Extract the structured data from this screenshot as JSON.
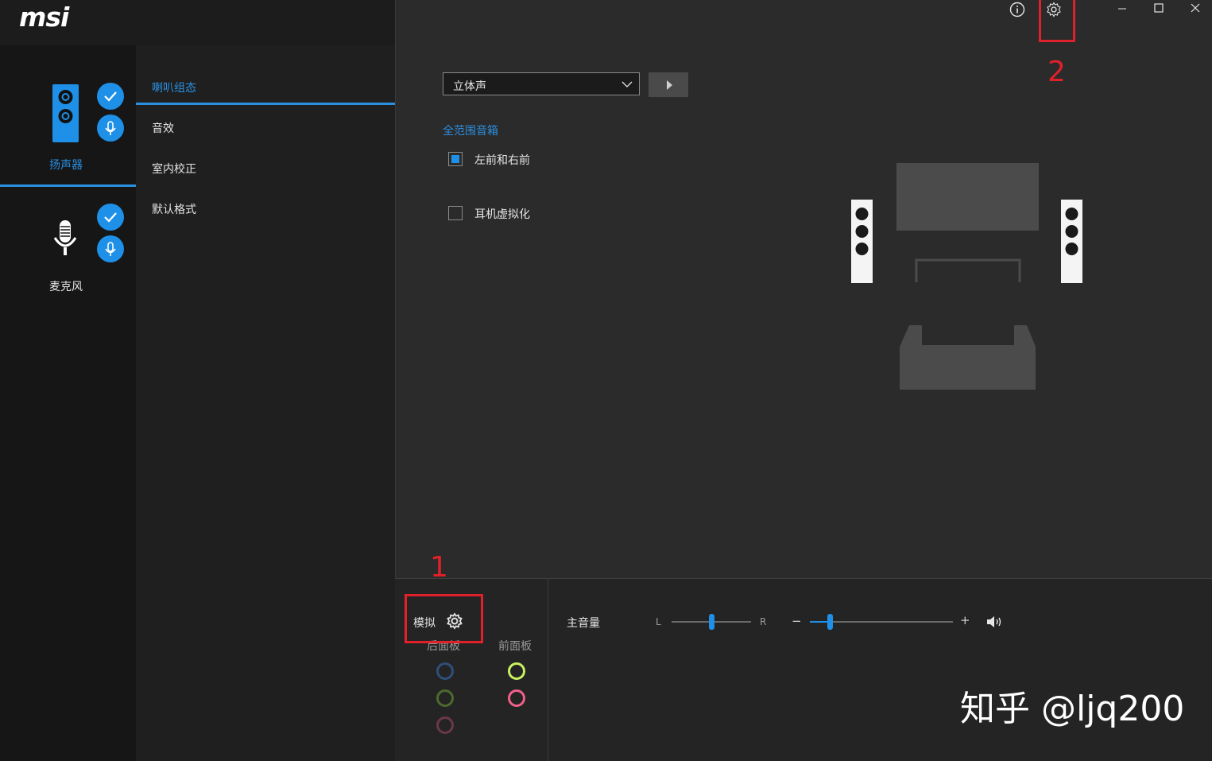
{
  "app": {
    "logo": "msi"
  },
  "devices": [
    {
      "label": "扬声器",
      "icon": "speaker-icon",
      "active": true
    },
    {
      "label": "麦克风",
      "icon": "microphone-icon",
      "active": false
    }
  ],
  "subnav": {
    "items": [
      {
        "label": "喇叭组态",
        "active": true
      },
      {
        "label": "音效",
        "active": false
      },
      {
        "label": "室内校正",
        "active": false
      },
      {
        "label": "默认格式",
        "active": false
      }
    ]
  },
  "main": {
    "config_select": {
      "value": "立体声"
    },
    "fullrange_title": "全范围音箱",
    "checkboxes": [
      {
        "label": "左前和右前",
        "checked": true
      },
      {
        "label": "耳机虚拟化",
        "checked": false
      }
    ]
  },
  "bottom": {
    "mode_label": "模拟",
    "rear_panel": "后面板",
    "front_panel": "前面板",
    "master_volume": "主音量",
    "balance_left": "L",
    "balance_right": "R",
    "balance_value": 0.5,
    "volume_value": 0.14,
    "minus": "−",
    "plus": "+"
  },
  "annotations": {
    "one": "1",
    "two": "2"
  },
  "watermark": "知乎 @ljq200",
  "colors": {
    "accent": "#1e90e8",
    "annotation": "#e0202a"
  }
}
